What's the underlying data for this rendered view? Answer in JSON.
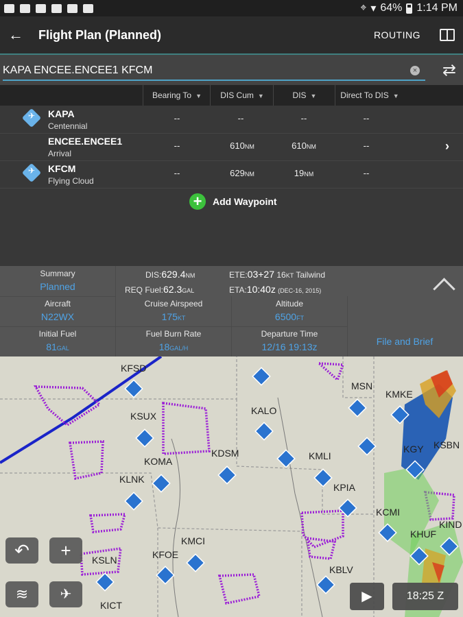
{
  "status_bar": {
    "battery": "64%",
    "time": "1:14 PM"
  },
  "app_bar": {
    "title": "Flight Plan (Planned)",
    "routing_label": "ROUTING"
  },
  "route": {
    "text": "KAPA ENCEE.ENCEE1 KFCM"
  },
  "columns": [
    "Bearing To",
    "DIS Cum",
    "DIS",
    "Direct To DIS"
  ],
  "waypoints": [
    {
      "id": "KAPA",
      "name": "Centennial",
      "bearing": "--",
      "dis_cum": "--",
      "dis_cum_unit": "",
      "dis": "--",
      "dis_unit": "",
      "direct": "--"
    },
    {
      "id": "ENCEE.ENCEE1",
      "name": "Arrival",
      "bearing": "--",
      "dis_cum": "610",
      "dis_cum_unit": "NM",
      "dis": "610",
      "dis_unit": "NM",
      "direct": "--"
    },
    {
      "id": "KFCM",
      "name": "Flying Cloud",
      "bearing": "--",
      "dis_cum": "629",
      "dis_cum_unit": "NM",
      "dis": "19",
      "dis_unit": "NM",
      "direct": "--"
    }
  ],
  "add_waypoint_label": "Add Waypoint",
  "summary": {
    "summary_label": "Summary",
    "summary_value": "Planned",
    "dis_label": "DIS:",
    "dis_value": "629.4",
    "dis_unit": "NM",
    "req_fuel_label": "REQ Fuel:",
    "req_fuel_value": "62.3",
    "req_fuel_unit": "GAL",
    "ete_label": "ETE:",
    "ete_value": "03+27",
    "wind_value": "16",
    "wind_unit": "KT",
    "wind_text": "Tailwind",
    "eta_label": "ETA:",
    "eta_value": "10:40z",
    "eta_date": "(DEC-16, 2015)",
    "aircraft_label": "Aircraft",
    "aircraft_value": "N22WX",
    "cruise_label": "Cruise Airspeed",
    "cruise_value": "175",
    "cruise_unit": "KT",
    "altitude_label": "Altitude",
    "altitude_value": "6500",
    "altitude_unit": "FT",
    "fuel_label": "Initial Fuel",
    "fuel_value": "81",
    "fuel_unit": "GAL",
    "burn_label": "Fuel Burn Rate",
    "burn_value": "18",
    "burn_unit": "GAL/H",
    "departure_label": "Departure Time",
    "departure_value": "12/16 19:13z",
    "file_brief_label": "File and Brief"
  },
  "map": {
    "airports": [
      "KFSD",
      "KSUX",
      "KALO",
      "KOMA",
      "KDSM",
      "KMLI",
      "KLNK",
      "KPIA",
      "KMCI",
      "KCMI",
      "KFOE",
      "KSLN",
      "KBLV",
      "KICT",
      "MSN",
      "KMKE",
      "KGY",
      "KSBN",
      "KHUF",
      "KIND"
    ],
    "zulu_time": "18:25 Z"
  }
}
